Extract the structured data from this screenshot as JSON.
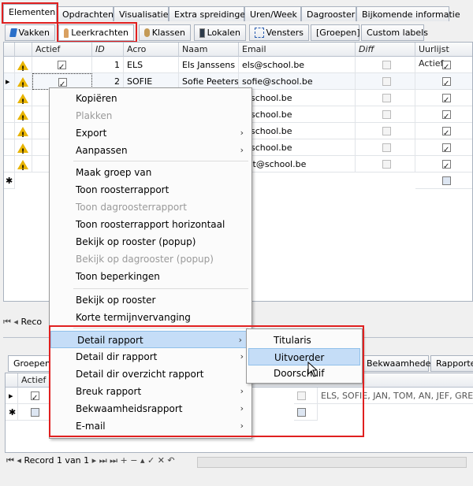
{
  "top_tabs": [
    "Elementen",
    "Opdrachten",
    "Visualisatie",
    "Extra spreidingen",
    "Uren/Week",
    "Dagrooster",
    "Bijkomende informatie"
  ],
  "sub_tabs": [
    "Vakken",
    "Leerkrachten",
    "Klassen",
    "Lokalen",
    "Vensters",
    "[Groepen]",
    "Custom labels"
  ],
  "grid": {
    "columns": [
      "Actief",
      "ID",
      "Acro",
      "Naam",
      "Email",
      "Diff",
      "Uurlijst Actief"
    ],
    "rows": [
      {
        "id": "1",
        "acro": "ELS",
        "naam": "Els Janssens",
        "email": "els@school.be"
      },
      {
        "id": "2",
        "acro": "SOFIE",
        "naam": "Sofie Peeters",
        "email": "sofie@school.be"
      },
      {
        "id": "",
        "acro": "",
        "naam": "",
        "email": "@school.be"
      },
      {
        "id": "",
        "acro": "",
        "naam": "",
        "email": "@school.be"
      },
      {
        "id": "",
        "acro": "",
        "naam": "",
        "email": "@school.be"
      },
      {
        "id": "",
        "acro": "",
        "naam": "",
        "email": "@school.be"
      },
      {
        "id": "",
        "acro": "",
        "naam": "",
        "email": "eet@school.be"
      }
    ],
    "row_markers": {
      "current": "▸",
      "new": "✱"
    }
  },
  "record_nav_top": {
    "label": "Reco"
  },
  "bottom": {
    "tabs": [
      "Groepen",
      "Bekwaamheden",
      "Rapporten"
    ],
    "col_actief": "Actief",
    "row_text": "ELS, SOFIE, JAN, TOM, AN, JEF, GRE",
    "record_label": "Record 1 van 1",
    "nav_symbols": [
      "⏮",
      "◂",
      "▸",
      "⏭",
      "⏭",
      "+",
      "−",
      "▴",
      "✓",
      "✕",
      "↶"
    ]
  },
  "context_menu": {
    "items": [
      {
        "label": "Kopiëren",
        "disabled": false
      },
      {
        "label": "Plakken",
        "disabled": true
      },
      {
        "label": "Export",
        "disabled": false,
        "submenu": true
      },
      {
        "label": "Aanpassen",
        "disabled": false,
        "submenu": true
      },
      {
        "label": "Maak groep van",
        "disabled": false
      },
      {
        "label": "Toon roosterrapport",
        "disabled": false
      },
      {
        "label": "Toon dagroosterrapport",
        "disabled": true
      },
      {
        "label": "Toon roosterrapport horizontaal",
        "disabled": false
      },
      {
        "label": "Bekijk op rooster (popup)",
        "disabled": false
      },
      {
        "label": "Bekijk op dagrooster (popup)",
        "disabled": true
      },
      {
        "label": "Toon beperkingen",
        "disabled": false
      },
      {
        "label": "Bekijk op rooster",
        "disabled": false
      },
      {
        "label": "Korte termijnvervanging",
        "disabled": false
      },
      {
        "label": "Detail rapport",
        "disabled": false,
        "submenu": true
      },
      {
        "label": "Detail dir rapport",
        "disabled": false,
        "submenu": true
      },
      {
        "label": "Detail dir overzicht rapport",
        "disabled": false
      },
      {
        "label": "Breuk rapport",
        "disabled": false,
        "submenu": true
      },
      {
        "label": "Bekwaamheidsrapport",
        "disabled": false,
        "submenu": true
      },
      {
        "label": "E-mail",
        "disabled": false,
        "submenu": true
      }
    ],
    "submenu_arrow": "›"
  },
  "submenu": {
    "items": [
      "Titularis",
      "Uitvoerder",
      "Doorschuif"
    ]
  },
  "colors": {
    "highlight_red": "#e02020",
    "selection": "#c5ddf7",
    "warning": "#e8b400"
  }
}
